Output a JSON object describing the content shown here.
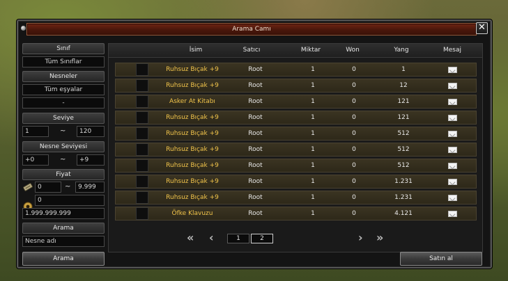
{
  "window": {
    "title": "Arama Camı",
    "close": "✕"
  },
  "filters": {
    "sinif_label": "Sınıf",
    "sinif_value": "Tüm Sınıflar",
    "nesneler_label": "Nesneler",
    "nesneler_value": "Tüm eşyalar",
    "nesneler_sub": "-",
    "seviye_label": "Seviye",
    "seviye_min": "1",
    "seviye_max": "120",
    "nesne_seviyesi_label": "Nesne Seviyesi",
    "nesne_seviyesi_min": "+0",
    "nesne_seviyesi_max": "+9",
    "fiyat_label": "Fiyat",
    "fiyat_min": "0",
    "fiyat_max": "9.999",
    "fiyat_won": "0",
    "fiyat_yang": "1.999.999.999",
    "tilde": "~",
    "arama_label": "Arama",
    "arama_placeholder": "Nesne adı"
  },
  "buttons": {
    "search": "Arama",
    "buy": "Satın al"
  },
  "table": {
    "headers": [
      "İsim",
      "Satıcı",
      "Miktar",
      "Won",
      "Yang",
      "Mesaj"
    ],
    "rows": [
      {
        "name": "Ruhsuz Bıçak +9",
        "seller": "Root",
        "qty": "1",
        "won": "0",
        "yang": "1"
      },
      {
        "name": "Ruhsuz Bıçak +9",
        "seller": "Root",
        "qty": "1",
        "won": "0",
        "yang": "12"
      },
      {
        "name": "Asker At Kitabı",
        "seller": "Root",
        "qty": "1",
        "won": "0",
        "yang": "121"
      },
      {
        "name": "Ruhsuz Bıçak +9",
        "seller": "Root",
        "qty": "1",
        "won": "0",
        "yang": "121"
      },
      {
        "name": "Ruhsuz Bıçak +9",
        "seller": "Root",
        "qty": "1",
        "won": "0",
        "yang": "512"
      },
      {
        "name": "Ruhsuz Bıçak +9",
        "seller": "Root",
        "qty": "1",
        "won": "0",
        "yang": "512"
      },
      {
        "name": "Ruhsuz Bıçak +9",
        "seller": "Root",
        "qty": "1",
        "won": "0",
        "yang": "512"
      },
      {
        "name": "Ruhsuz Bıçak +9",
        "seller": "Root",
        "qty": "1",
        "won": "0",
        "yang": "1.231"
      },
      {
        "name": "Ruhsuz Bıçak +9",
        "seller": "Root",
        "qty": "1",
        "won": "0",
        "yang": "1.231"
      },
      {
        "name": "Öfke Klavuzu",
        "seller": "Root",
        "qty": "1",
        "won": "0",
        "yang": "4.121"
      }
    ]
  },
  "pager": {
    "first": "«",
    "prev": "‹",
    "next": "›",
    "last": "»",
    "pages": [
      "1",
      "2"
    ],
    "current_page": 2
  },
  "icons": {
    "won_icon": "won-coin-icon",
    "yang_icon": "yang-coin-icon",
    "mail_icon": "mail-icon"
  },
  "colors": {
    "title_bar": "#5a1c0e",
    "item_name": "#f0c34a",
    "row_bg": "#3b3422"
  }
}
